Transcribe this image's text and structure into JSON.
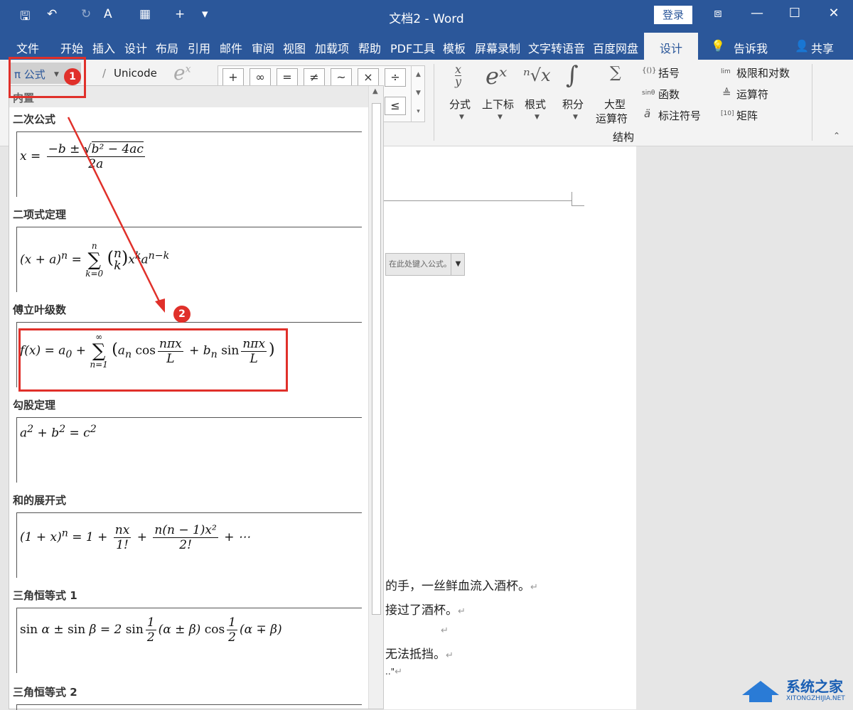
{
  "titlebar": {
    "title": "文档2 - Word",
    "login": "登录",
    "qa_save": "🖫",
    "qa_undo": "↶",
    "qa_redo": "↻",
    "qa_format": "A",
    "qa_layout": "▦",
    "qa_new": "+",
    "qa_more": "▾",
    "win_restore": "⧈",
    "win_min": "—",
    "win_max": "☐",
    "win_close": "✕"
  },
  "tabs": [
    "文件",
    "开始",
    "插入",
    "设计",
    "布局",
    "引用",
    "邮件",
    "审阅",
    "视图",
    "加载项",
    "帮助",
    "PDF工具",
    "模板",
    "屏幕录制",
    "文字转语音",
    "百度网盘"
  ],
  "active_tab": "设计",
  "tell_me": "告诉我",
  "share": "共享",
  "ribbon": {
    "equation_btn": "π 公式",
    "unicode": "Unicode",
    "symbols": [
      "+",
      "∞",
      "=",
      "≠",
      "~",
      "×",
      "÷",
      "!",
      "∝",
      "<",
      "≪",
      ">",
      "≫",
      "≤"
    ],
    "structures": {
      "fraction": "分式",
      "script": "上下标",
      "radical": "根式",
      "integral": "积分",
      "large_op_1": "大型",
      "large_op_2": "运算符",
      "bracket": "括号",
      "function": "函数",
      "accent": "标注符号",
      "limit_log": "极限和对数",
      "operator": "运算符",
      "matrix": "矩阵",
      "group_label": "结构"
    },
    "icons": {
      "fraction_x": "x",
      "fraction_y": "y",
      "script": "eˣ",
      "radical": "ⁿ√x",
      "integral": "∫",
      "bracket_icon": "{()}",
      "function_icon": "sinθ",
      "accent_icon": "ä",
      "limit_icon": "lim",
      "operator_icon": "≜",
      "matrix_icon": "[10]"
    }
  },
  "gallery": {
    "header": "内置",
    "items": [
      {
        "title": "二次公式"
      },
      {
        "title": "二项式定理"
      },
      {
        "title": "傅立叶级数"
      },
      {
        "title": "勾股定理"
      },
      {
        "title": "和的展开式"
      },
      {
        "title": "三角恒等式 1"
      },
      {
        "title": "三角恒等式 2"
      }
    ]
  },
  "doc": {
    "placeholder": "在此处键入公式。",
    "lines": [
      "的手，一丝鲜血流入酒杯。",
      "接过了酒杯。",
      "",
      "无法抵挡。",
      "..\""
    ],
    "para_mark": "↵"
  },
  "badges": [
    "1",
    "2"
  ],
  "watermark": {
    "text": "系统之家",
    "sub": "XITONGZHIJIA.NET"
  }
}
